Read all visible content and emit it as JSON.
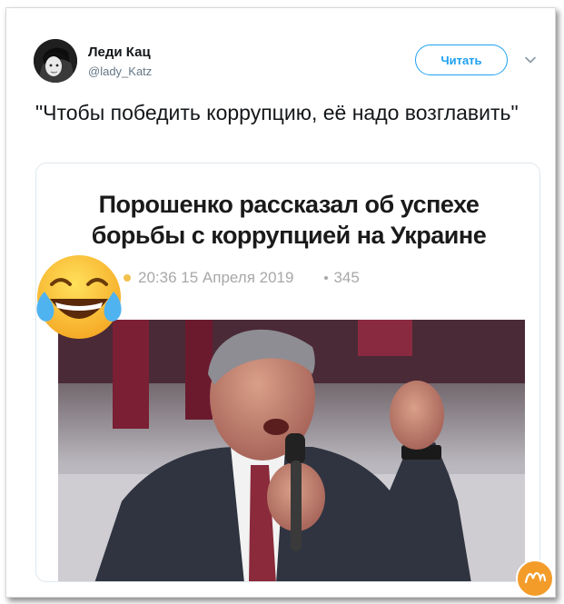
{
  "tweet": {
    "author_name": "Леди Кац",
    "author_handle": "@lady_Katz",
    "follow_label": "Читать",
    "text": "\"Чтобы победить коррупцию, её надо возглавить\""
  },
  "card": {
    "headline": "Порошенко рассказал об успехе борьбы с коррупцией на Украине",
    "timestamp": "20:36 15 Апреля 2019",
    "views": "345"
  },
  "icons": {
    "avatar": "avatar-portrait",
    "chevron": "chevron-down-icon",
    "emoji": "tears-of-joy-emoji",
    "watermark": "site-logo"
  },
  "colors": {
    "accent": "#1da1f2",
    "text": "#14171a",
    "muted": "#657786",
    "meta_dot": "#f2c14e"
  }
}
